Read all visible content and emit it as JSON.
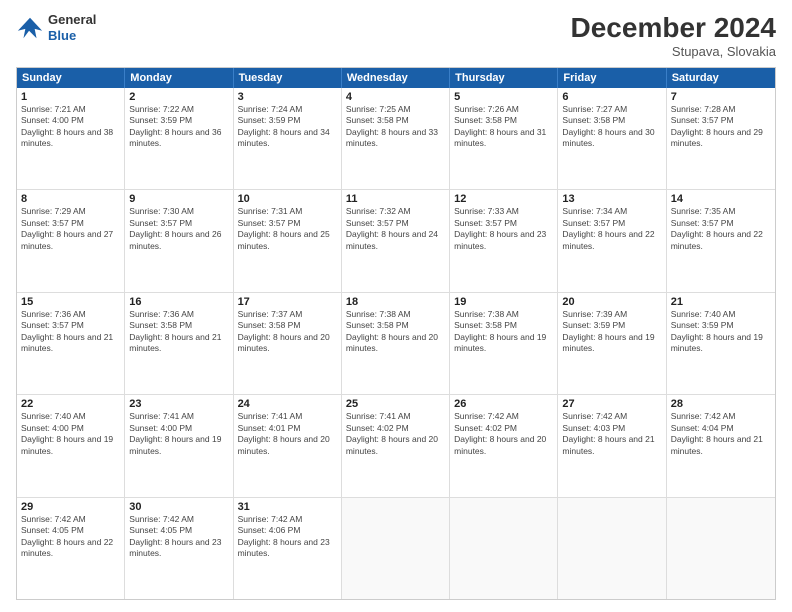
{
  "header": {
    "logo_line1": "General",
    "logo_line2": "Blue",
    "month_title": "December 2024",
    "location": "Stupava, Slovakia"
  },
  "weekdays": [
    "Sunday",
    "Monday",
    "Tuesday",
    "Wednesday",
    "Thursday",
    "Friday",
    "Saturday"
  ],
  "weeks": [
    [
      {
        "day": "1",
        "sunrise": "7:21 AM",
        "sunset": "4:00 PM",
        "daylight": "8 hours and 38 minutes."
      },
      {
        "day": "2",
        "sunrise": "7:22 AM",
        "sunset": "3:59 PM",
        "daylight": "8 hours and 36 minutes."
      },
      {
        "day": "3",
        "sunrise": "7:24 AM",
        "sunset": "3:59 PM",
        "daylight": "8 hours and 34 minutes."
      },
      {
        "day": "4",
        "sunrise": "7:25 AM",
        "sunset": "3:58 PM",
        "daylight": "8 hours and 33 minutes."
      },
      {
        "day": "5",
        "sunrise": "7:26 AM",
        "sunset": "3:58 PM",
        "daylight": "8 hours and 31 minutes."
      },
      {
        "day": "6",
        "sunrise": "7:27 AM",
        "sunset": "3:58 PM",
        "daylight": "8 hours and 30 minutes."
      },
      {
        "day": "7",
        "sunrise": "7:28 AM",
        "sunset": "3:57 PM",
        "daylight": "8 hours and 29 minutes."
      }
    ],
    [
      {
        "day": "8",
        "sunrise": "7:29 AM",
        "sunset": "3:57 PM",
        "daylight": "8 hours and 27 minutes."
      },
      {
        "day": "9",
        "sunrise": "7:30 AM",
        "sunset": "3:57 PM",
        "daylight": "8 hours and 26 minutes."
      },
      {
        "day": "10",
        "sunrise": "7:31 AM",
        "sunset": "3:57 PM",
        "daylight": "8 hours and 25 minutes."
      },
      {
        "day": "11",
        "sunrise": "7:32 AM",
        "sunset": "3:57 PM",
        "daylight": "8 hours and 24 minutes."
      },
      {
        "day": "12",
        "sunrise": "7:33 AM",
        "sunset": "3:57 PM",
        "daylight": "8 hours and 23 minutes."
      },
      {
        "day": "13",
        "sunrise": "7:34 AM",
        "sunset": "3:57 PM",
        "daylight": "8 hours and 22 minutes."
      },
      {
        "day": "14",
        "sunrise": "7:35 AM",
        "sunset": "3:57 PM",
        "daylight": "8 hours and 22 minutes."
      }
    ],
    [
      {
        "day": "15",
        "sunrise": "7:36 AM",
        "sunset": "3:57 PM",
        "daylight": "8 hours and 21 minutes."
      },
      {
        "day": "16",
        "sunrise": "7:36 AM",
        "sunset": "3:58 PM",
        "daylight": "8 hours and 21 minutes."
      },
      {
        "day": "17",
        "sunrise": "7:37 AM",
        "sunset": "3:58 PM",
        "daylight": "8 hours and 20 minutes."
      },
      {
        "day": "18",
        "sunrise": "7:38 AM",
        "sunset": "3:58 PM",
        "daylight": "8 hours and 20 minutes."
      },
      {
        "day": "19",
        "sunrise": "7:38 AM",
        "sunset": "3:58 PM",
        "daylight": "8 hours and 19 minutes."
      },
      {
        "day": "20",
        "sunrise": "7:39 AM",
        "sunset": "3:59 PM",
        "daylight": "8 hours and 19 minutes."
      },
      {
        "day": "21",
        "sunrise": "7:40 AM",
        "sunset": "3:59 PM",
        "daylight": "8 hours and 19 minutes."
      }
    ],
    [
      {
        "day": "22",
        "sunrise": "7:40 AM",
        "sunset": "4:00 PM",
        "daylight": "8 hours and 19 minutes."
      },
      {
        "day": "23",
        "sunrise": "7:41 AM",
        "sunset": "4:00 PM",
        "daylight": "8 hours and 19 minutes."
      },
      {
        "day": "24",
        "sunrise": "7:41 AM",
        "sunset": "4:01 PM",
        "daylight": "8 hours and 20 minutes."
      },
      {
        "day": "25",
        "sunrise": "7:41 AM",
        "sunset": "4:02 PM",
        "daylight": "8 hours and 20 minutes."
      },
      {
        "day": "26",
        "sunrise": "7:42 AM",
        "sunset": "4:02 PM",
        "daylight": "8 hours and 20 minutes."
      },
      {
        "day": "27",
        "sunrise": "7:42 AM",
        "sunset": "4:03 PM",
        "daylight": "8 hours and 21 minutes."
      },
      {
        "day": "28",
        "sunrise": "7:42 AM",
        "sunset": "4:04 PM",
        "daylight": "8 hours and 21 minutes."
      }
    ],
    [
      {
        "day": "29",
        "sunrise": "7:42 AM",
        "sunset": "4:05 PM",
        "daylight": "8 hours and 22 minutes."
      },
      {
        "day": "30",
        "sunrise": "7:42 AM",
        "sunset": "4:05 PM",
        "daylight": "8 hours and 23 minutes."
      },
      {
        "day": "31",
        "sunrise": "7:42 AM",
        "sunset": "4:06 PM",
        "daylight": "8 hours and 23 minutes."
      },
      null,
      null,
      null,
      null
    ]
  ]
}
